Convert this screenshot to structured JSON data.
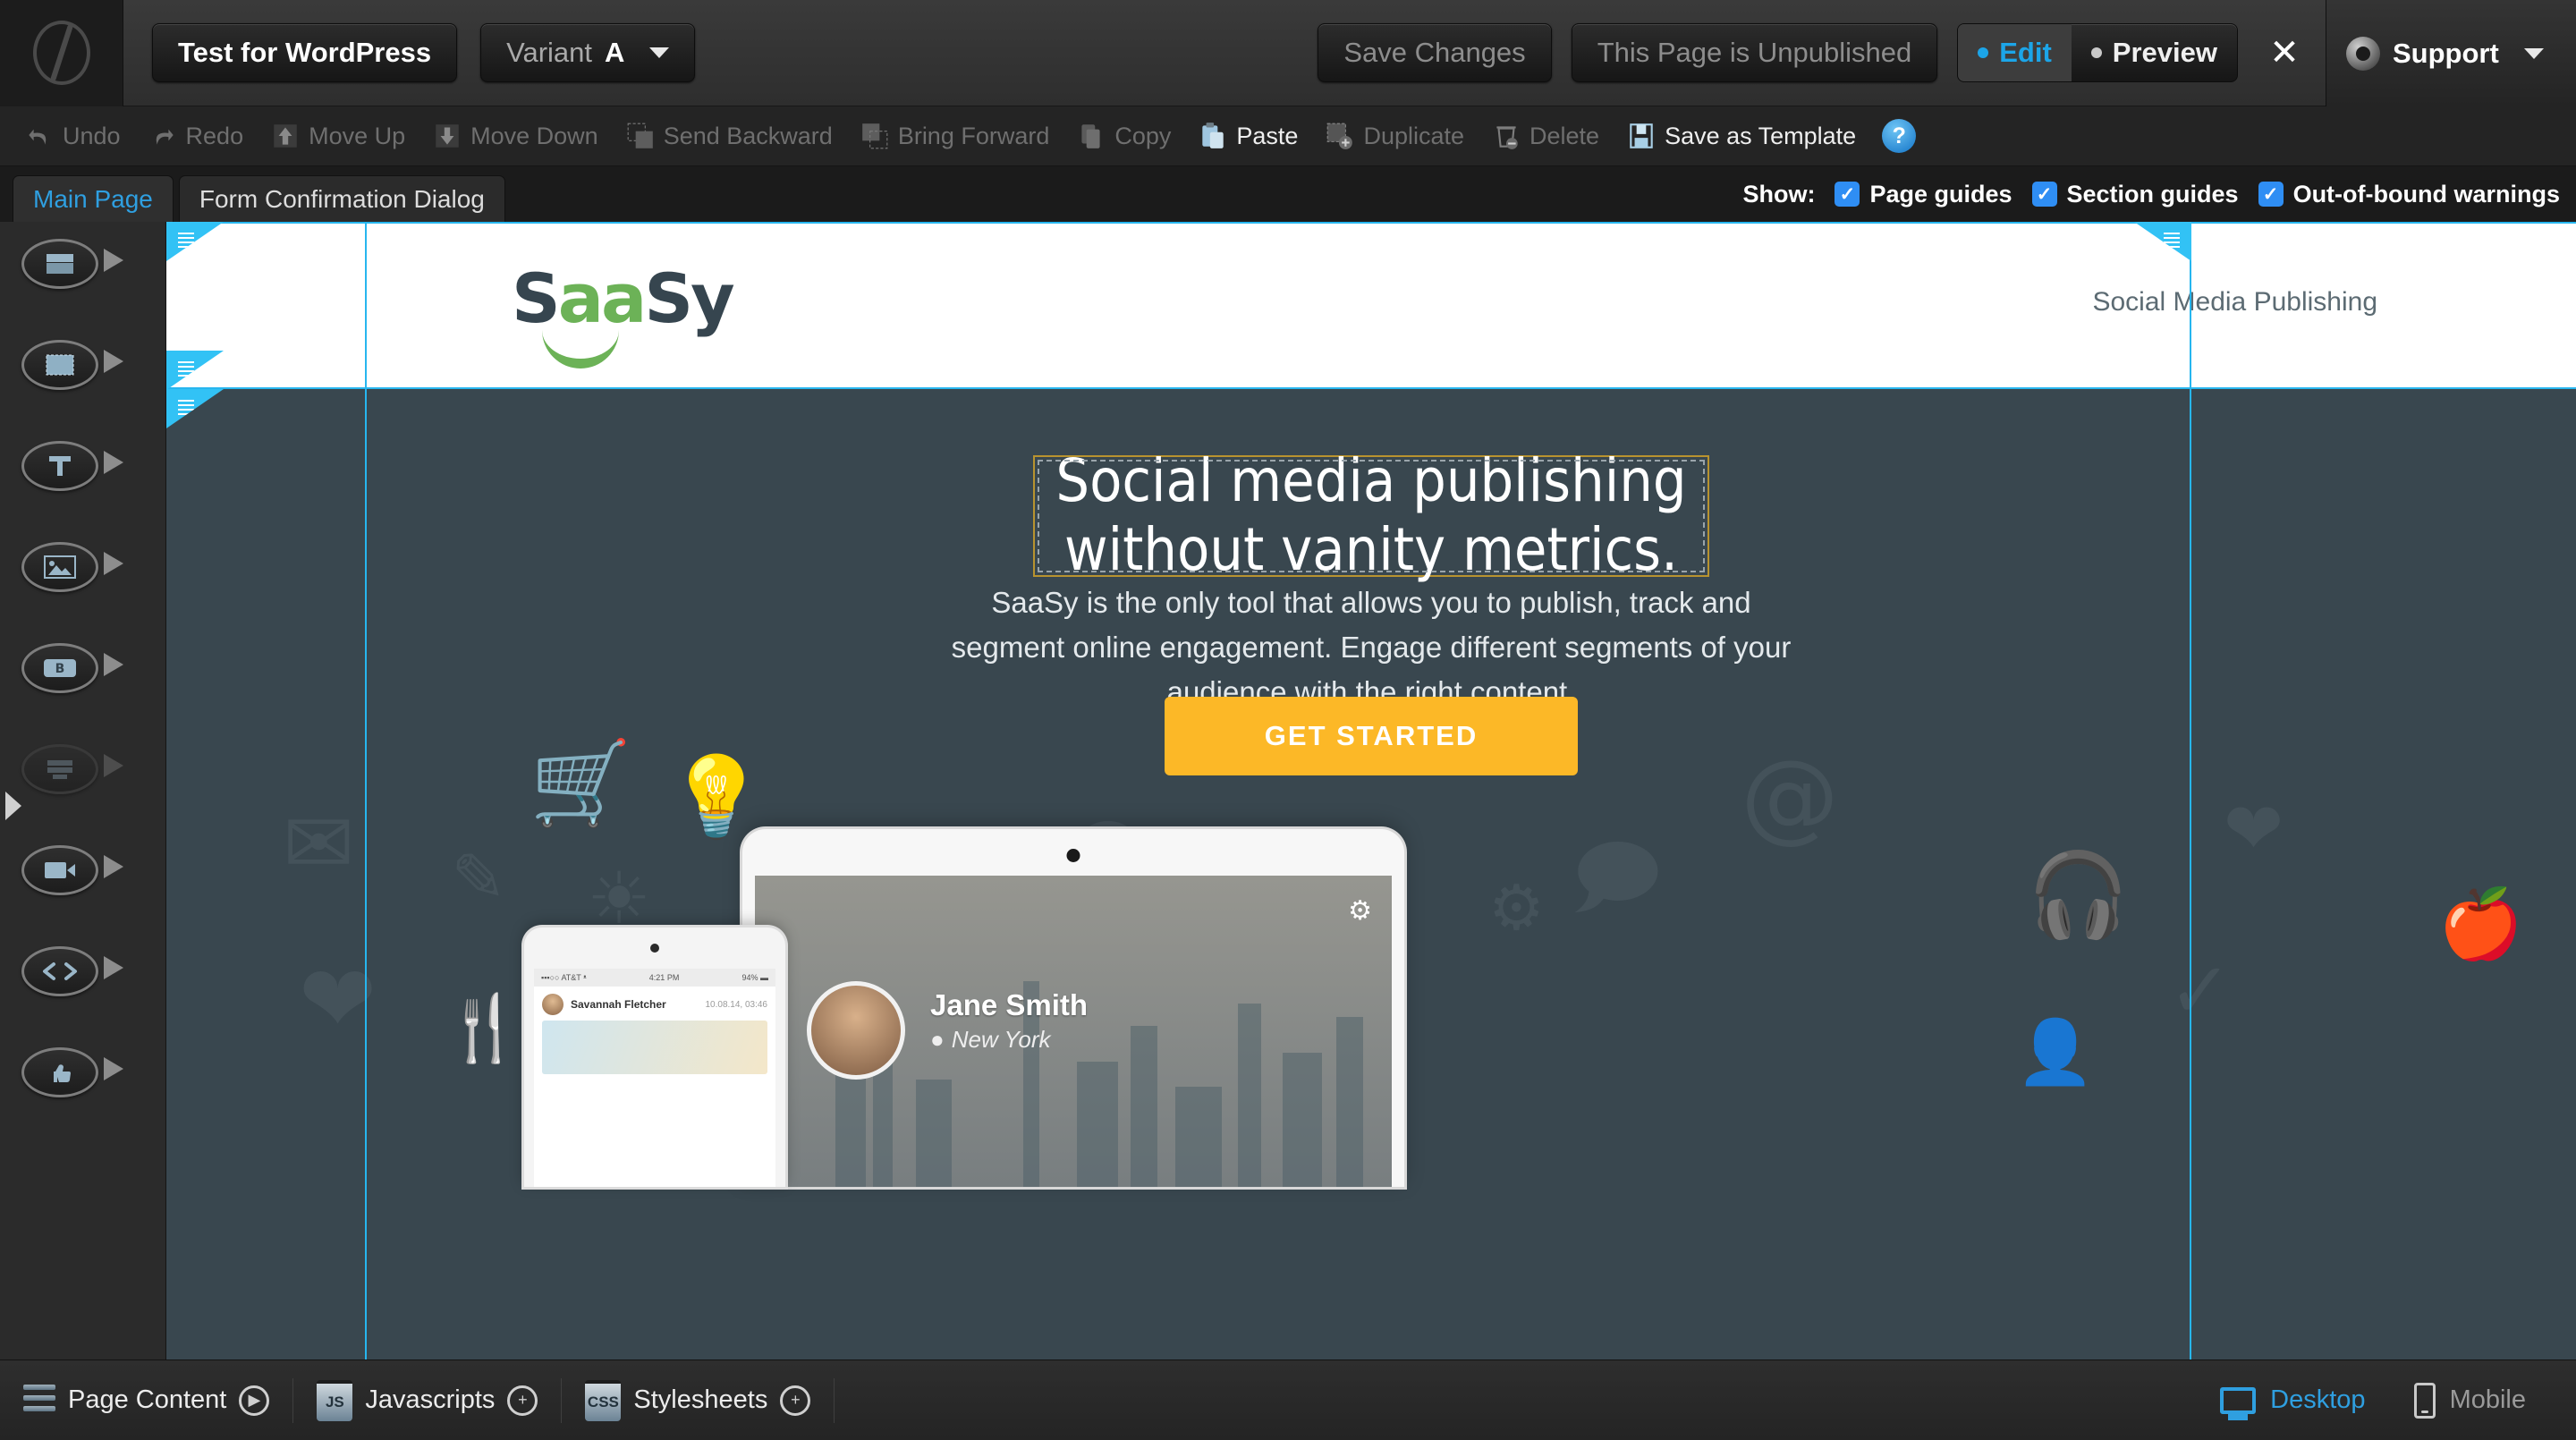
{
  "topbar": {
    "logo_icon": "unbounce-logo-icon",
    "page_title": "Test for WordPress",
    "variant_label": "Variant",
    "variant_value": "A",
    "save_label": "Save Changes",
    "publish_status": "This Page is Unpublished",
    "edit_label": "Edit",
    "preview_label": "Preview",
    "close_label": "✕",
    "support_label": "Support"
  },
  "actionbar": {
    "items": [
      {
        "label": "Undo",
        "icon": "undo-icon",
        "enabled": false
      },
      {
        "label": "Redo",
        "icon": "redo-icon",
        "enabled": false
      },
      {
        "label": "Move Up",
        "icon": "move-up-icon",
        "enabled": false
      },
      {
        "label": "Move Down",
        "icon": "move-down-icon",
        "enabled": false
      },
      {
        "label": "Send Backward",
        "icon": "send-backward-icon",
        "enabled": false
      },
      {
        "label": "Bring Forward",
        "icon": "bring-forward-icon",
        "enabled": false
      },
      {
        "label": "Copy",
        "icon": "copy-icon",
        "enabled": false
      },
      {
        "label": "Paste",
        "icon": "paste-icon",
        "enabled": true
      },
      {
        "label": "Duplicate",
        "icon": "duplicate-icon",
        "enabled": false
      },
      {
        "label": "Delete",
        "icon": "delete-icon",
        "enabled": false
      },
      {
        "label": "Save as Template",
        "icon": "save-template-icon",
        "enabled": true
      }
    ],
    "help_label": "?"
  },
  "tabbar": {
    "tabs": [
      {
        "label": "Main Page",
        "active": true
      },
      {
        "label": "Form Confirmation Dialog",
        "active": false
      }
    ],
    "show_label": "Show:",
    "toggles": [
      {
        "label": "Page guides",
        "checked": true
      },
      {
        "label": "Section guides",
        "checked": true
      },
      {
        "label": "Out-of-bound warnings",
        "checked": true
      }
    ],
    "check_glyph": "✓"
  },
  "rail": {
    "tools": [
      {
        "name": "section-tool",
        "enabled": true
      },
      {
        "name": "box-tool",
        "enabled": true
      },
      {
        "name": "text-tool",
        "enabled": true
      },
      {
        "name": "image-tool",
        "enabled": true
      },
      {
        "name": "button-tool",
        "enabled": true
      },
      {
        "name": "form-tool",
        "enabled": false
      },
      {
        "name": "video-tool",
        "enabled": true
      },
      {
        "name": "custom-html-tool",
        "enabled": true
      },
      {
        "name": "social-widget-tool",
        "enabled": true
      }
    ]
  },
  "canvas": {
    "site_header": {
      "logo_text_1": "S",
      "logo_text_2": "aa",
      "logo_text_3": "S",
      "logo_text_4": "y",
      "tagline": "Social Media Publishing"
    },
    "hero": {
      "headline_line1": "Social media publishing",
      "headline_line2": "without vanity metrics.",
      "subtext": "SaaSy is the only tool that allows you to publish, track and segment online engagement. Engage different segments of your audience with the right content.",
      "cta_label": "GET STARTED",
      "background_icons": [
        "envelope-icon",
        "pencil-icon",
        "heart-icon",
        "fork-knife-icon",
        "shopping-cart-icon",
        "lightbulb-icon",
        "sun-icon",
        "wifi-icon",
        "briefcase-icon",
        "www-text-icon",
        "paper-plane-icon",
        "smiley-icon",
        "at-sign-icon",
        "speech-bubble-icon",
        "headphones-icon",
        "heart-icon-2",
        "apple-icon",
        "check-icon",
        "gear-icon",
        "person-icon"
      ],
      "device_mockups": {
        "tablet": {
          "profile_name": "Jane Smith",
          "profile_location": "New York",
          "location_pin_icon": "map-pin-icon",
          "gear_icon": "gear-icon"
        },
        "phone": {
          "status_left": "▪▪▪○○ AT&T ᵜ",
          "status_center": "4:21 PM",
          "status_right": "94% ▬",
          "post_author": "Savannah Fletcher",
          "post_time": "10.08.14, 03:46",
          "clock_icon": "clock-icon"
        }
      }
    }
  },
  "bottombar": {
    "page_content_label": "Page Content",
    "page_content_icon": "hamburger-icon",
    "page_content_expand_icon": "play-circle-icon",
    "javascripts_label": "Javascripts",
    "javascripts_badge": "JS",
    "javascripts_add_icon": "plus-circle-icon",
    "stylesheets_label": "Stylesheets",
    "stylesheets_badge": "CSS",
    "stylesheets_add_icon": "plus-circle-icon",
    "desktop_label": "Desktop",
    "desktop_icon": "monitor-icon",
    "mobile_label": "Mobile",
    "mobile_icon": "phone-icon",
    "add_glyph": "+",
    "play_glyph": "▶"
  },
  "colors": {
    "accent_blue": "#2f9fe0",
    "guide_cyan": "#27b6ef",
    "hero_bg": "#39474f",
    "cta_amber": "#fcb827",
    "brand_green": "#6cb257",
    "selection_gold": "#b8932f"
  }
}
